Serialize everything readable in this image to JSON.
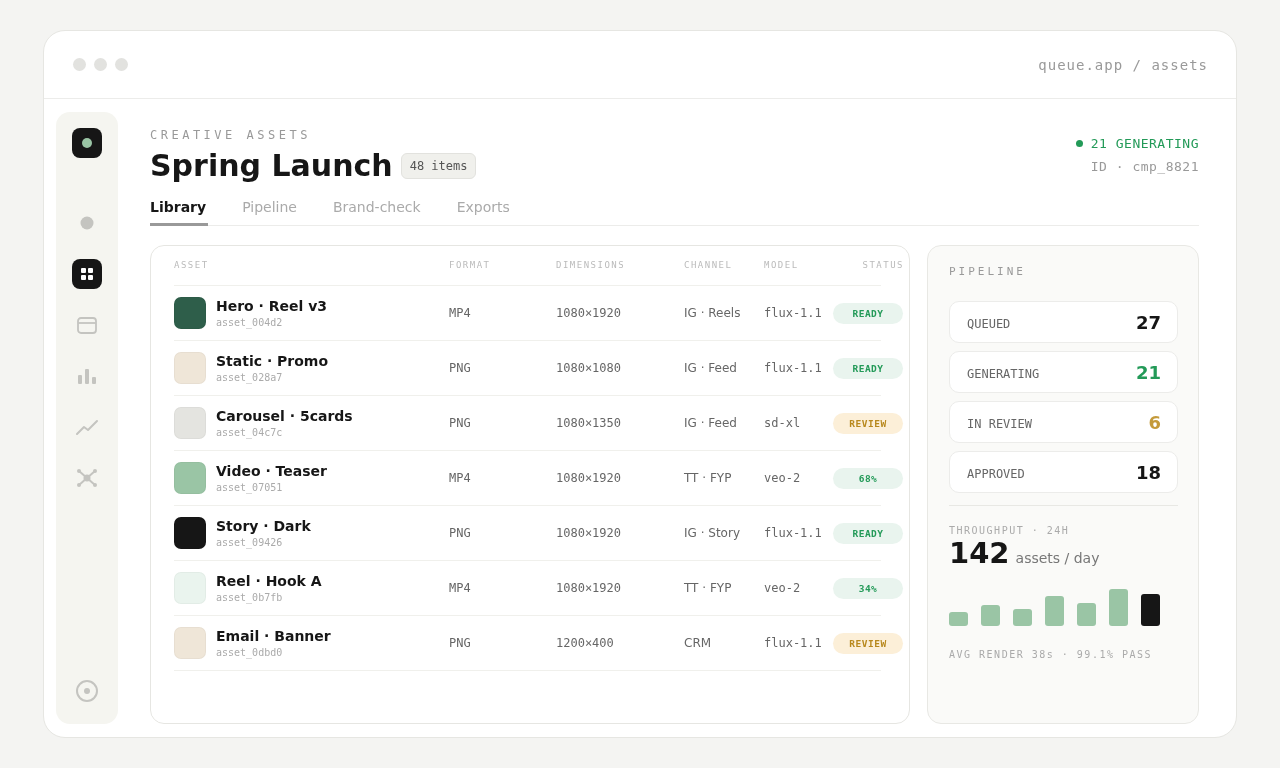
{
  "window": {
    "address": "queue.app / assets"
  },
  "sidebar": {
    "items": [
      {
        "kind": "dot",
        "selected": false
      },
      {
        "kind": "grid",
        "selected": true
      },
      {
        "kind": "card",
        "selected": false
      },
      {
        "kind": "bars",
        "selected": false
      },
      {
        "kind": "line",
        "selected": false
      },
      {
        "kind": "network",
        "selected": false
      }
    ],
    "footer": {
      "kind": "target",
      "selected": false
    }
  },
  "header": {
    "eyebrow": "CREATIVE ASSETS",
    "title": "Spring Launch",
    "count": "48 items",
    "live": "21 GENERATING",
    "id": "ID · cmp_8821"
  },
  "tabs": [
    {
      "label": "Library",
      "selected": true
    },
    {
      "label": "Pipeline",
      "selected": false
    },
    {
      "label": "Brand-check",
      "selected": false
    },
    {
      "label": "Exports",
      "selected": false
    }
  ],
  "table": {
    "columns": [
      "ASSET",
      "FORMAT",
      "DIMENSIONS",
      "CHANNEL",
      "MODEL",
      "STATUS"
    ],
    "rows": [
      {
        "name": "Hero · Reel v3",
        "id": "asset_004d2",
        "color": "#2e5e4a",
        "format": "MP4",
        "dimensions": "1080×1920",
        "channel": "IG · Reels",
        "model": "flux-1.1",
        "status": {
          "kind": "ready",
          "label": "READY"
        }
      },
      {
        "name": "Static · Promo",
        "id": "asset_028a7",
        "color": "#efe6d8",
        "format": "PNG",
        "dimensions": "1080×1080",
        "channel": "IG · Feed",
        "model": "flux-1.1",
        "status": {
          "kind": "ready",
          "label": "READY"
        }
      },
      {
        "name": "Carousel · 5cards",
        "id": "asset_04c7c",
        "color": "#e4e4e0",
        "format": "PNG",
        "dimensions": "1080×1350",
        "channel": "IG · Feed",
        "model": "sd-xl",
        "status": {
          "kind": "review",
          "label": "REVIEW"
        }
      },
      {
        "name": "Video · Teaser",
        "id": "asset_07051",
        "color": "#9ac5a5",
        "format": "MP4",
        "dimensions": "1080×1920",
        "channel": "TT · FYP",
        "model": "veo-2",
        "status": {
          "kind": "progress",
          "label": "68%"
        }
      },
      {
        "name": "Story · Dark",
        "id": "asset_09426",
        "color": "#161616",
        "format": "PNG",
        "dimensions": "1080×1920",
        "channel": "IG · Story",
        "model": "flux-1.1",
        "status": {
          "kind": "ready",
          "label": "READY"
        }
      },
      {
        "name": "Reel · Hook A",
        "id": "asset_0b7fb",
        "color": "#eaf4ee",
        "format": "MP4",
        "dimensions": "1080×1920",
        "channel": "TT · FYP",
        "model": "veo-2",
        "status": {
          "kind": "progress",
          "label": "34%"
        }
      },
      {
        "name": "Email · Banner",
        "id": "asset_0dbd0",
        "color": "#efe6d8",
        "format": "PNG",
        "dimensions": "1200×400",
        "channel": "CRM",
        "model": "flux-1.1",
        "status": {
          "kind": "review",
          "label": "REVIEW"
        }
      }
    ]
  },
  "pipeline": {
    "title": "PIPELINE",
    "stats": [
      {
        "label": "QUEUED",
        "value": "27",
        "color": "#161616"
      },
      {
        "label": "GENERATING",
        "value": "21",
        "color": "#239a58"
      },
      {
        "label": "IN REVIEW",
        "value": "6",
        "color": "#c49a3a"
      },
      {
        "label": "APPROVED",
        "value": "18",
        "color": "#161616"
      }
    ],
    "throughput": {
      "label": "THROUGHPUT · 24H",
      "value": "142",
      "unit": "assets / day"
    },
    "footer": "AVG RENDER 38s · 99.1% PASS"
  }
}
